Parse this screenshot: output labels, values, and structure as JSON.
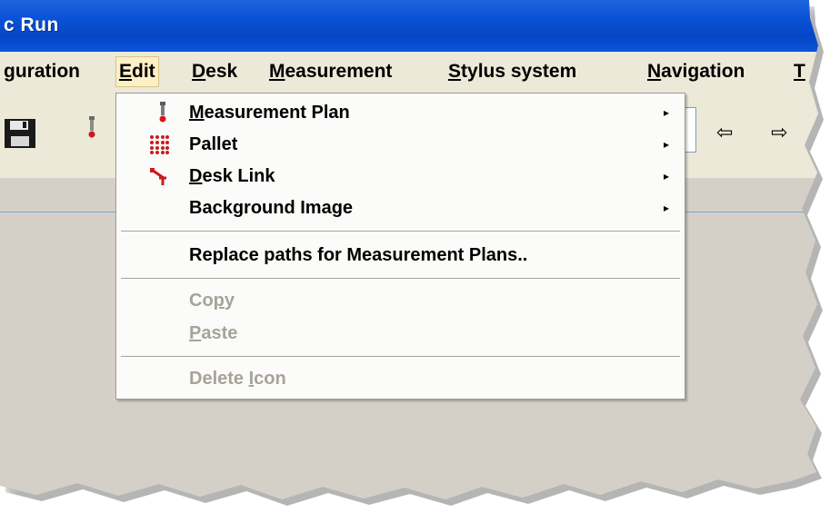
{
  "window": {
    "title": "c Run"
  },
  "menubar": {
    "items": [
      {
        "label_pre": "",
        "label_ul": "",
        "label_post": "guration"
      },
      {
        "label_pre": "",
        "label_ul": "E",
        "label_post": "dit"
      },
      {
        "label_pre": "",
        "label_ul": "D",
        "label_post": "esk"
      },
      {
        "label_pre": "",
        "label_ul": "M",
        "label_post": "easurement"
      },
      {
        "label_pre": "",
        "label_ul": "S",
        "label_post": "tylus system"
      },
      {
        "label_pre": "",
        "label_ul": "N",
        "label_post": "avigation"
      },
      {
        "label_pre": "",
        "label_ul": "T",
        "label_post": ""
      }
    ]
  },
  "toolbar": {
    "save_icon": "floppy-disk-icon",
    "probe_icon": "probe-icon",
    "back_icon": "back-arrow-icon",
    "forward_icon": "forward-arrow-icon"
  },
  "edit_menu": {
    "items": [
      {
        "label_pre": "",
        "label_ul": "M",
        "label_post": "easurement Plan",
        "icon": "probe-icon",
        "submenu": true,
        "enabled": true
      },
      {
        "label_pre": "",
        "label_ul": "",
        "label_post": "Pallet",
        "icon": "pallet-grid-icon",
        "submenu": true,
        "enabled": true
      },
      {
        "label_pre": "",
        "label_ul": "D",
        "label_post": "esk Link",
        "icon": "desk-link-icon",
        "submenu": true,
        "enabled": true
      },
      {
        "label_pre": "",
        "label_ul": "",
        "label_post": "Background Image",
        "icon": "",
        "submenu": true,
        "enabled": true
      },
      {
        "label_pre": "",
        "label_ul": "",
        "label_post": "Replace paths for Measurement Plans..",
        "icon": "",
        "submenu": false,
        "enabled": true
      },
      {
        "label_pre": "Co",
        "label_ul": "p",
        "label_post": "y",
        "icon": "",
        "submenu": false,
        "enabled": false
      },
      {
        "label_pre": "",
        "label_ul": "P",
        "label_post": "aste",
        "icon": "",
        "submenu": false,
        "enabled": false
      },
      {
        "label_pre": "Delete ",
        "label_ul": "I",
        "label_post": "con",
        "icon": "",
        "submenu": false,
        "enabled": false
      }
    ],
    "submenu_arrow": "▸"
  },
  "colors": {
    "title_bar": "#0a52d6",
    "menu_bar": "#ece9d8",
    "active_menu": "#fdf0c6",
    "disabled_text": "#a7a39a",
    "icon_red": "#cc1b1b"
  }
}
